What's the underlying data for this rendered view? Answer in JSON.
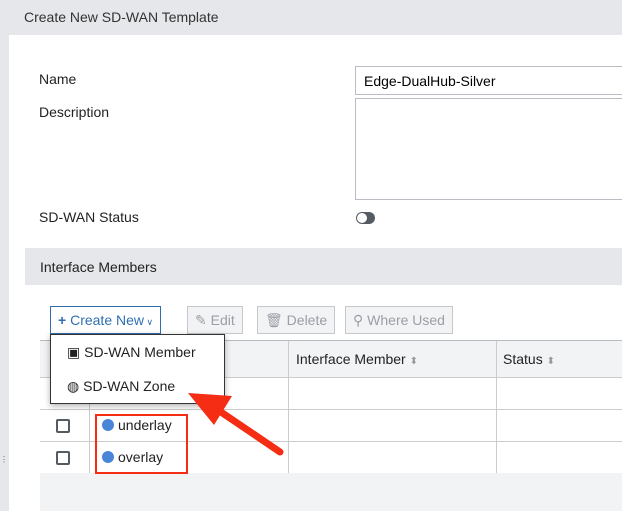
{
  "header": {
    "title": "Create New SD-WAN Template"
  },
  "form": {
    "name_label": "Name",
    "name_value": "Edge-DualHub-Silver",
    "description_label": "Description",
    "description_value": "",
    "status_label": "SD-WAN Status",
    "status_enabled": false
  },
  "section": {
    "title": "Interface Members"
  },
  "toolbar": {
    "create_new": "Create New",
    "edit": "Edit",
    "delete": "Delete",
    "where_used": "Where Used"
  },
  "menu": {
    "items": [
      "SD-WAN Member",
      "SD-WAN Zone"
    ]
  },
  "table": {
    "columns": [
      "",
      "",
      "Interface Member",
      "Status"
    ],
    "rows": [
      {
        "name": "underlay"
      },
      {
        "name": "overlay"
      }
    ]
  },
  "colors": {
    "accent": "#2f6fb0",
    "annotation": "#f42d14"
  }
}
